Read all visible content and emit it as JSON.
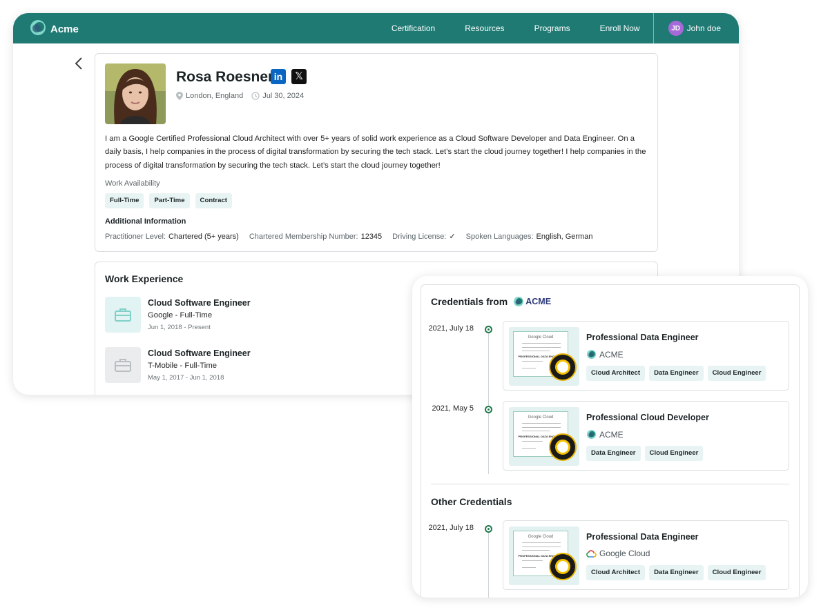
{
  "nav": {
    "brand": "Acme",
    "items": [
      "Certification",
      "Resources",
      "Programs",
      "Enroll Now"
    ],
    "user": {
      "initials": "JD",
      "name": "John doe"
    }
  },
  "profile": {
    "name": "Rosa Roesner",
    "social": {
      "linkedin": "in",
      "x": "𝕏"
    },
    "location": "London, England",
    "date": "Jul 30, 2024",
    "bio": "I am a Google Certified Professional Cloud Architect with over 5+ years of solid work experience as a Cloud Software Developer and Data Engineer. On a daily basis, I help companies in the process of digital transformation by securing the tech stack. Let’s start the cloud journey together! I help companies in the process of digital transformation by securing the tech stack. Let’s start the cloud journey together!",
    "work_availability_label": "Work Availability",
    "availability": [
      "Full-Time",
      "Part-Time",
      "Contract"
    ],
    "additional_label": "Additional Information",
    "info": {
      "level_k": "Practitioner Level:",
      "level_v": "Chartered (5+ years)",
      "member_k": "Chartered Membership Number:",
      "member_v": "12345",
      "license_k": "Driving License:",
      "license_v": "✓",
      "lang_k": "Spoken Languages:",
      "lang_v": "English, German"
    }
  },
  "work": {
    "title": "Work Experience",
    "jobs": [
      {
        "title": "Cloud Software Engineer",
        "company": "Google - Full-Time",
        "dates": "Jun 1, 2018 - Present"
      },
      {
        "title": "Cloud Software Engineer",
        "company": "T-Mobile - Full-Time",
        "dates": "May 1, 2017 - Jun 1, 2018"
      }
    ]
  },
  "credentials": {
    "title": "Credentials from",
    "issuer_logo_text": "ACME",
    "items": [
      {
        "date": "2021, July 18",
        "title": "Professional Data Engineer",
        "issuer": "ACME",
        "tags": [
          "Cloud Architect",
          "Data Engineer",
          "Cloud Engineer"
        ]
      },
      {
        "date": "2021, May 5",
        "title": "Professional Cloud Developer",
        "issuer": "ACME",
        "tags": [
          "Data Engineer",
          "Cloud Engineer"
        ]
      }
    ],
    "other_title": "Other Credentials",
    "other": [
      {
        "date": "2021, July 18",
        "title": "Professional Data Engineer",
        "issuer": "Google Cloud",
        "tags": [
          "Cloud Architect",
          "Data Engineer",
          "Cloud Engineer"
        ]
      }
    ],
    "cert_thumb": {
      "header": "Google Cloud",
      "cert_title": "PROFESSIONAL DATA ENGINEER"
    }
  },
  "colors": {
    "brand": "#1f7a74",
    "tag_bg": "#e8f4f3",
    "timeline": "#1f7a4a"
  }
}
